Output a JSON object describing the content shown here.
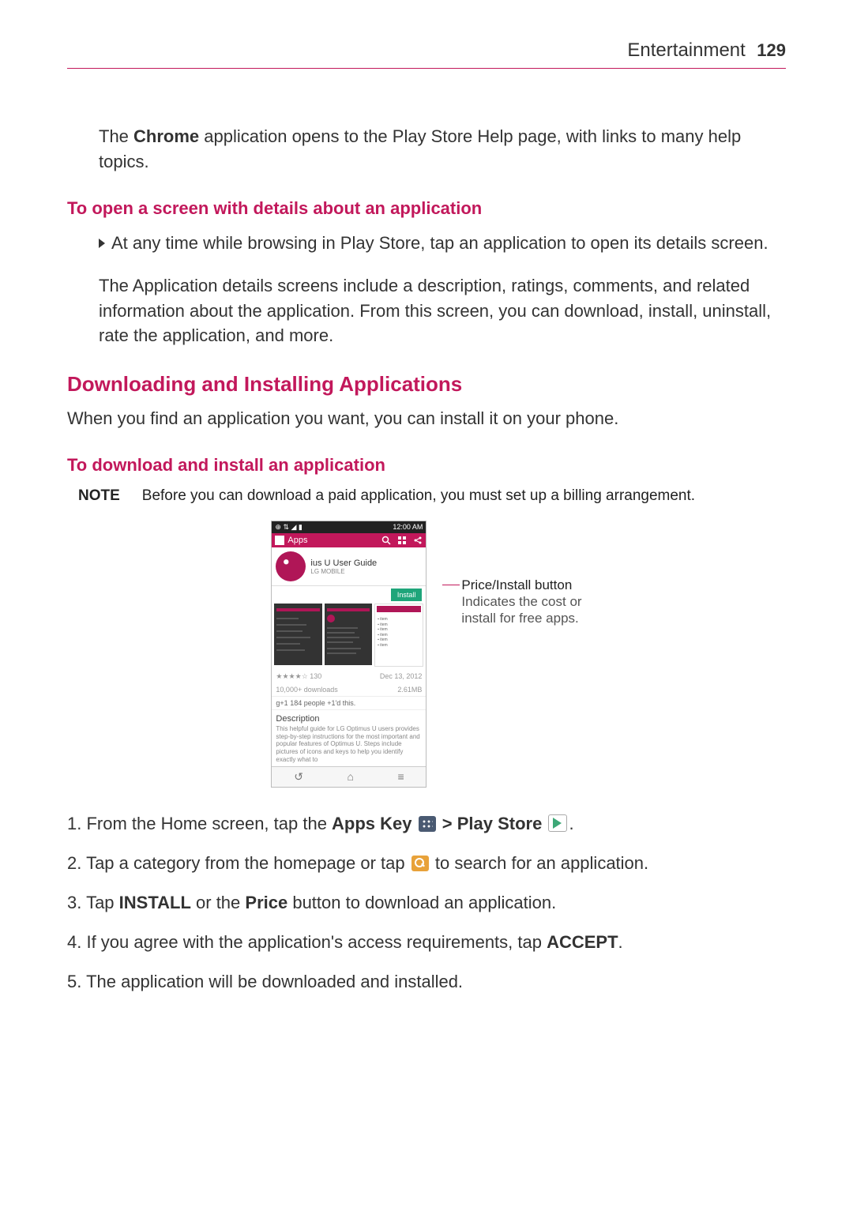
{
  "header": {
    "section": "Entertainment",
    "page": "129"
  },
  "intro": {
    "pre": "The ",
    "chrome": "Chrome",
    "post": " application opens to the Play Store Help page, with links to many help topics."
  },
  "open_details": {
    "heading": "To open a screen with details about an application",
    "bullet": "At any time while browsing in Play Store, tap an application to open its details screen.",
    "para": "The Application details screens include a description, ratings, comments, and related information about the application. From this screen, you can download, install, uninstall, rate the application, and more."
  },
  "downloading": {
    "heading": "Downloading and Installing Applications",
    "para": "When you find an application you want, you can install it on your phone."
  },
  "install": {
    "heading": "To download and install an application",
    "note_label": "NOTE",
    "note_text": "Before you can download a paid application, you must set up a billing arrangement."
  },
  "screenshot": {
    "status_left": "⊕ ⇅ ◢ ▮",
    "status_right": "12:00 AM",
    "apps_label": "Apps",
    "app_title": "ius U User Guide",
    "app_sub": "LG MOBILE",
    "install_btn": "Install",
    "stars": "★★★★☆  130",
    "stars_right": "Dec 13, 2012",
    "downloads": "10,000+ downloads",
    "size": "2.61MB",
    "plus": "g+1  184 people +1'd this.",
    "desc_head": "Description",
    "desc_body": "This helpful guide for LG Optimus U users provides step-by-step instructions for the most important and popular features of Optimus U. Steps include pictures of icons and keys to help you identify exactly what to"
  },
  "callout": {
    "title": "Price/Install button",
    "sub1": "Indicates the cost or",
    "sub2": "install for free apps."
  },
  "steps": {
    "s1a": "1. From the Home screen, tap the ",
    "s1b": "Apps Key",
    "s1c": " > ",
    "s1d": "Play Store",
    "s1e": ".",
    "s2a": "2. Tap a category from the homepage or tap ",
    "s2b": " to search for an application.",
    "s3a": "3. Tap ",
    "s3b": "INSTALL",
    "s3c": " or the ",
    "s3d": "Price",
    "s3e": " button to download an application.",
    "s4a": "4. If you agree with the application's access requirements, tap ",
    "s4b": "ACCEPT",
    "s4c": ".",
    "s5": "5. The application will be downloaded and installed."
  }
}
